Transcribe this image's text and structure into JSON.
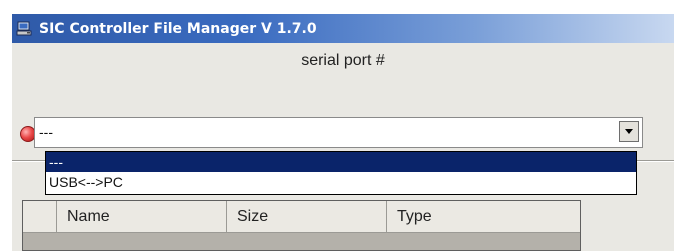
{
  "window": {
    "title": "SIC Controller File Manager V 1.7.0",
    "title_icon": "computer-icon"
  },
  "serial_port": {
    "label": "serial port #",
    "status_led": "red-led-icon",
    "selected_value": "---",
    "dropdown_icon": "chevron-down-icon",
    "options": [
      {
        "label": "---",
        "selected": true
      },
      {
        "label": "USB<-->PC",
        "selected": false
      }
    ]
  },
  "file_table": {
    "columns": [
      "",
      "Name",
      "Size",
      "Type"
    ]
  },
  "colors": {
    "titlebar": "#3a6bc0",
    "selection": "#0a246a",
    "led": "#ea4a4a"
  }
}
